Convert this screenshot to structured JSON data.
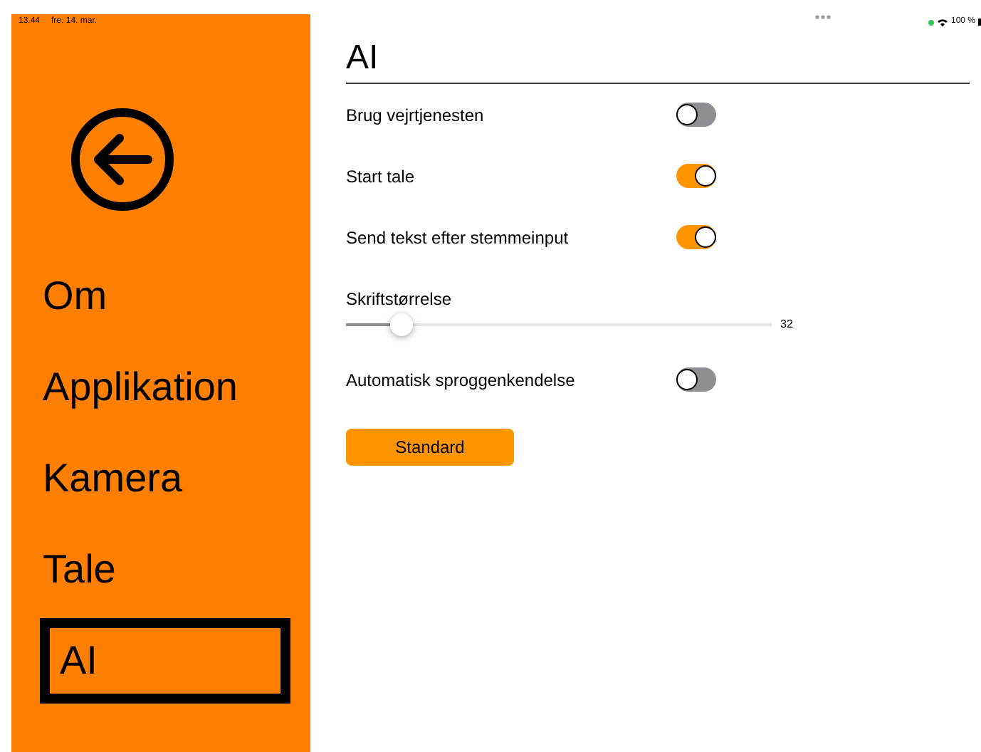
{
  "status_bar": {
    "time": "13.44",
    "date": "fre. 14. mar.",
    "battery": "100 %"
  },
  "sidebar": {
    "items": [
      {
        "label": "Om",
        "selected": false
      },
      {
        "label": "Applikation",
        "selected": false
      },
      {
        "label": "Kamera",
        "selected": false
      },
      {
        "label": "Tale",
        "selected": false
      },
      {
        "label": "AI",
        "selected": true
      }
    ]
  },
  "title": "AI",
  "settings": [
    {
      "kind": "toggle",
      "label": "Brug vejrtjenesten",
      "on": false
    },
    {
      "kind": "toggle",
      "label": "Start tale",
      "on": true
    },
    {
      "kind": "toggle",
      "label": "Send tekst efter stemmeinput",
      "on": true
    },
    {
      "kind": "slider",
      "label": "Skriftstørrelse",
      "level": 0.13,
      "reading": "32"
    },
    {
      "kind": "toggle",
      "label": "Automatisk sproggenkendelse",
      "on": false
    }
  ],
  "button": "Standard"
}
